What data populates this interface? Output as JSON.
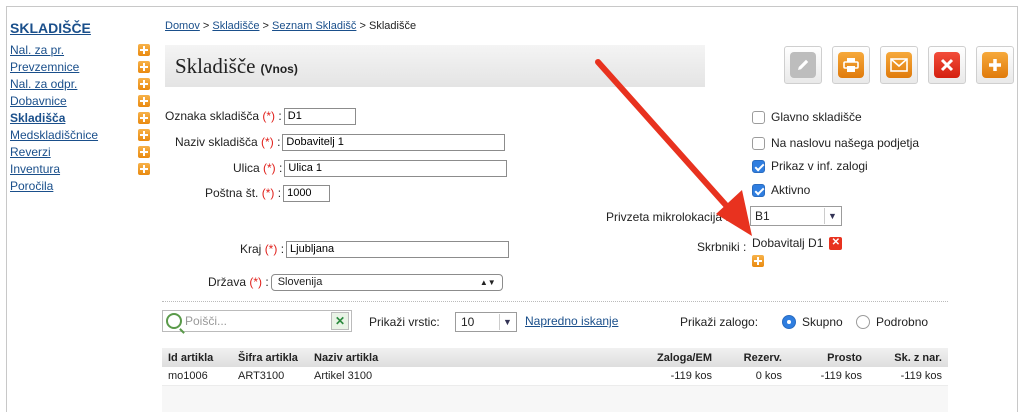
{
  "sidebar": {
    "title": "SKLADIŠČE",
    "items": [
      {
        "label": "Nal. za pr.",
        "plus": true,
        "active": false
      },
      {
        "label": "Prevzemnice",
        "plus": true,
        "active": false
      },
      {
        "label": "Nal. za odpr.",
        "plus": true,
        "active": false
      },
      {
        "label": "Dobavnice",
        "plus": true,
        "active": false
      },
      {
        "label": "Skladišča",
        "plus": true,
        "active": true
      },
      {
        "label": "Medskladiščnice",
        "plus": true,
        "active": false
      },
      {
        "label": "Reverzi",
        "plus": true,
        "active": false
      },
      {
        "label": "Inventura",
        "plus": true,
        "active": false
      },
      {
        "label": "Poročila",
        "plus": false,
        "active": false
      }
    ]
  },
  "breadcrumb": {
    "home": "Domov",
    "sep": ">",
    "level1": "Skladišče",
    "level2": "Seznam Skladišč",
    "current": "Skladišče"
  },
  "page": {
    "title": "Skladišče",
    "subtitle": "(Vnos)"
  },
  "toolbar": {
    "edit": "pencil-icon",
    "print": "printer-icon",
    "mail": "envelope-icon",
    "delete": "close-icon",
    "add": "plus-icon"
  },
  "form": {
    "required_mark": "(*)",
    "colon": ":",
    "oznaka": {
      "label": "Oznaka skladišča",
      "value": "D1"
    },
    "naziv": {
      "label": "Naziv skladišča",
      "value": "Dobavitelj 1"
    },
    "ulica": {
      "label": "Ulica",
      "value": "Ulica 1"
    },
    "postna": {
      "label": "Poštna št.",
      "value": "1000"
    },
    "kraj": {
      "label": "Kraj",
      "value": "Ljubljana"
    },
    "drzava": {
      "label": "Država",
      "value": "Slovenija"
    }
  },
  "options": {
    "glavno": {
      "label": "Glavno skladišče",
      "checked": false
    },
    "naslov": {
      "label": "Na naslovu našega podjetja",
      "checked": false
    },
    "prikaz": {
      "label": "Prikaz v inf. zalogi",
      "checked": true
    },
    "aktivno": {
      "label": "Aktivno",
      "checked": true
    },
    "mikrolokacija_label": "Privzeta mikrolokacija",
    "mikrolokacija_value": "B1",
    "skrbniki_label": "Skrbniki",
    "skrbnik": "Dobavitalj D1"
  },
  "list": {
    "search_placeholder": "Poišči...",
    "rows_label": "Prikaži vrstic:",
    "rows_value": "10",
    "advanced": "Napredno iskanje",
    "stock_label": "Prikaži zalogo:",
    "radio_group": "Skupno",
    "radio_detail": "Podrobno",
    "columns": [
      "Id artikla",
      "Šifra artikla",
      "Naziv artikla",
      "Zaloga/EM",
      "Rezerv.",
      "Prosto",
      "Sk. z nar."
    ],
    "rows": [
      [
        "mo1006",
        "ART3100",
        "Artikel 3100",
        "-119 kos",
        "0 kos",
        "-119 kos",
        "-119 kos"
      ]
    ]
  },
  "colors": {
    "link": "#1a4f8b",
    "required": "#e0201b",
    "accent_orange": "#e98a10",
    "accent_red": "#e8321f",
    "check_blue": "#2f7ee0",
    "arrow": "#e8321f"
  }
}
